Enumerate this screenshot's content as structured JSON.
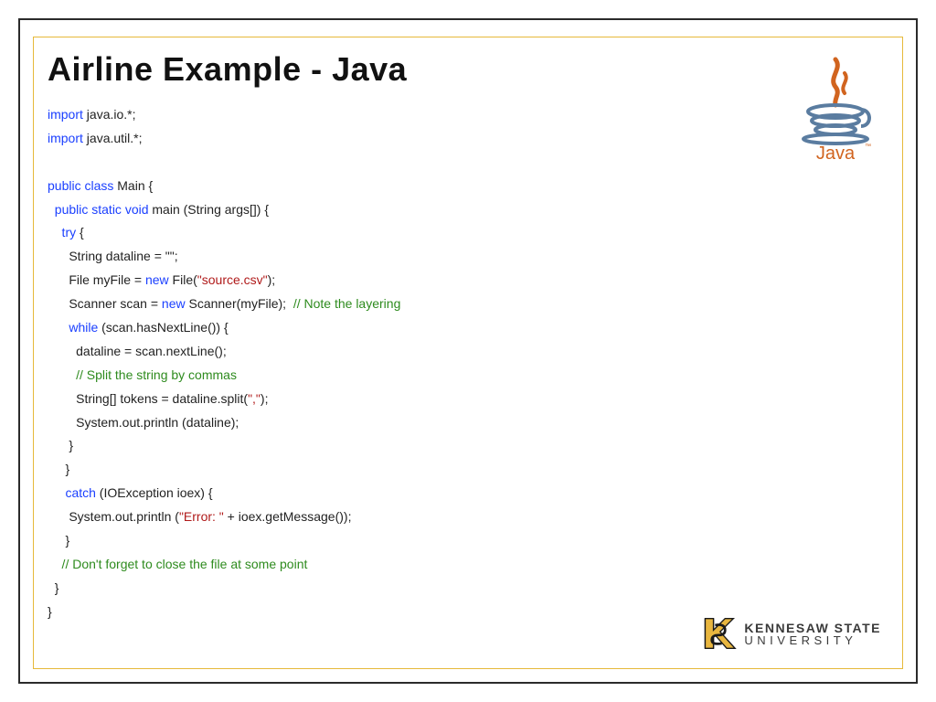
{
  "title": "Airline Example - Java",
  "code": {
    "l1a": "import",
    "l1b": " java.io.*;",
    "l2a": "import",
    "l2b": " java.util.*;",
    "l3a": "public class",
    "l3b": " Main {",
    "l4a": "  public static void",
    "l4b": " main (String args[]) {",
    "l5a": "    try",
    "l5b": " {",
    "l6": "      String dataline = \"\";",
    "l7a": "      File myFile = ",
    "l7b": "new",
    "l7c": " File(",
    "l7d": "\"source.csv\"",
    "l7e": ");",
    "l8a": "      Scanner scan = ",
    "l8b": "new",
    "l8c": " Scanner(myFile);  ",
    "l8d": "// Note the layering",
    "l9a": "      while",
    "l9b": " (scan.hasNextLine()) {",
    "l10": "        dataline = scan.nextLine();",
    "l11": "        // Split the string by commas",
    "l12a": "        String[] tokens = dataline.split(",
    "l12b": "\",\"",
    "l12c": ");",
    "l13": "        System.out.println (dataline);",
    "l14": "      }",
    "l15": "     }",
    "l16a": "     catch",
    "l16b": " (IOException ioex) {",
    "l17a": "      System.out.println (",
    "l17b": "\"Error: \"",
    "l17c": " + ioex.getMessage());",
    "l18": "     }",
    "l19": "    // Don't forget to close the file at some point",
    "l20": "  }",
    "l21": "}"
  },
  "logos": {
    "java": "Java",
    "ksu1": "KENNESAW STATE",
    "ksu2": "UNIVERSITY"
  }
}
